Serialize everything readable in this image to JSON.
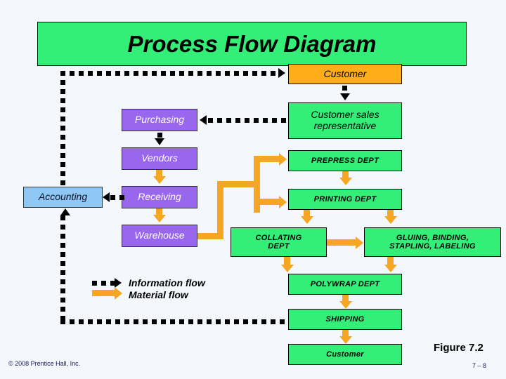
{
  "slide": {
    "title": "Process Flow Diagram",
    "figure_label": "Figure 7.2",
    "page_number": "7 – 8",
    "copyright": "© 2008 Prentice Hall, Inc."
  },
  "colors": {
    "title_banner": "#33ee77",
    "background": "#f4f8fc",
    "purple_node": "#9966ee",
    "blue_node": "#8fc8f5",
    "orange_node": "#ffae1a",
    "green_node": "#33ee77",
    "material_flow": "#f5a623",
    "information_flow": "#000000"
  },
  "nodes": {
    "customer_top": "Customer",
    "purchasing": "Purchasing",
    "vendors": "Vendors",
    "accounting": "Accounting",
    "receiving": "Receiving",
    "warehouse": "Warehouse",
    "customer_sales_rep": "Customer sales\nrepresentative",
    "customer_sales_rep_line1": "Customer sales",
    "customer_sales_rep_line2": "representative",
    "prepress_dept": "PREPRESS DEPT",
    "printing_dept": "PRINTING DEPT",
    "collating_dept_line1": "COLLATING",
    "collating_dept_line2": "DEPT",
    "gluing_line1": "GLUING, BINDING,",
    "gluing_line2": "STAPLING, LABELING",
    "polywrap_dept": "POLYWRAP DEPT",
    "shipping": "SHIPPING",
    "customer_bottom": "Customer"
  },
  "legend": {
    "information_flow": "Information flow",
    "material_flow": "Material flow"
  }
}
